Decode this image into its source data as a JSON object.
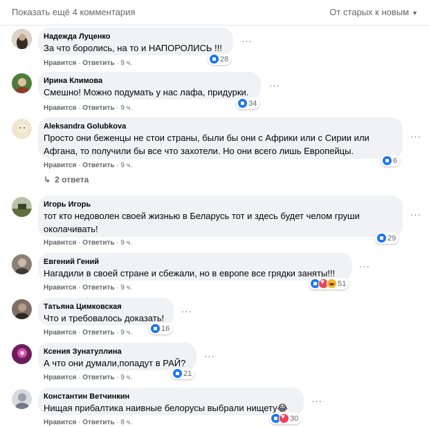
{
  "header": {
    "show_more": "Показать ещё 4 комментария",
    "sort_label": "От старых к новым"
  },
  "action_like": "Нравится",
  "action_reply": "Ответить",
  "sep": "·",
  "comments": [
    {
      "author": "Надежда Луценко",
      "text": "За что боролись, на то и НАПОРОЛИСЬ !!!",
      "time": "9 ч.",
      "reactions": "28",
      "avatar_color": "#5a4a3a"
    },
    {
      "author": "Ирина Климова",
      "text": "Смешно! Можно подумать у нас лафа, придурки.",
      "time": "9 ч.",
      "reactions": "34",
      "avatar_color": "#3f6b2a"
    },
    {
      "author": "Aleksandra Golubkova",
      "text": "Просто они беженцы не стои страны, были бы они с Африки или с Сирии или Афгана, то получили бы все что захотели. Но они всего лишь Европейцы.",
      "time": "9 ч.",
      "reactions": "6",
      "avatar_color": "#e8dcc0"
    },
    {
      "author": "Игорь Игорь",
      "text": "тот кто недоволен своей жизнью в Беларусь тот и здесь будет челом груши околачивать!",
      "time": "9 ч.",
      "reactions": "29",
      "avatar_color": "#6c7a4e"
    },
    {
      "author": "Евгений Гений",
      "text": "Нагадили в своей стране и сбежали, но в европе все грядки заняты!!!",
      "time": "9 ч.",
      "reactions": "51",
      "avatar_color": "#8a7f74"
    },
    {
      "author": "Татьяна Цимковская",
      "text": "Что и требовалось доказать!",
      "time": "9 ч.",
      "reactions": "16",
      "avatar_color": "#7d6f66"
    },
    {
      "author": "Ксения Зунатуллина",
      "text": "А что они думали,попадут в РАЙ?",
      "time": "9 ч.",
      "reactions": "21",
      "avatar_color": "#b5348a"
    },
    {
      "author": "Константин Ветчинкин",
      "text": "Нищая прибалтика наивные белорусы выбрали нищету😂",
      "time": "8 ч.",
      "reactions": "30",
      "avatar_color": "#9aa3ad"
    }
  ],
  "replies_label": "2 ответа",
  "colors": {
    "like": "#1877f2",
    "heart": "#f33e58",
    "haha": "#f7b125",
    "bubble": "#f0f2f5"
  }
}
